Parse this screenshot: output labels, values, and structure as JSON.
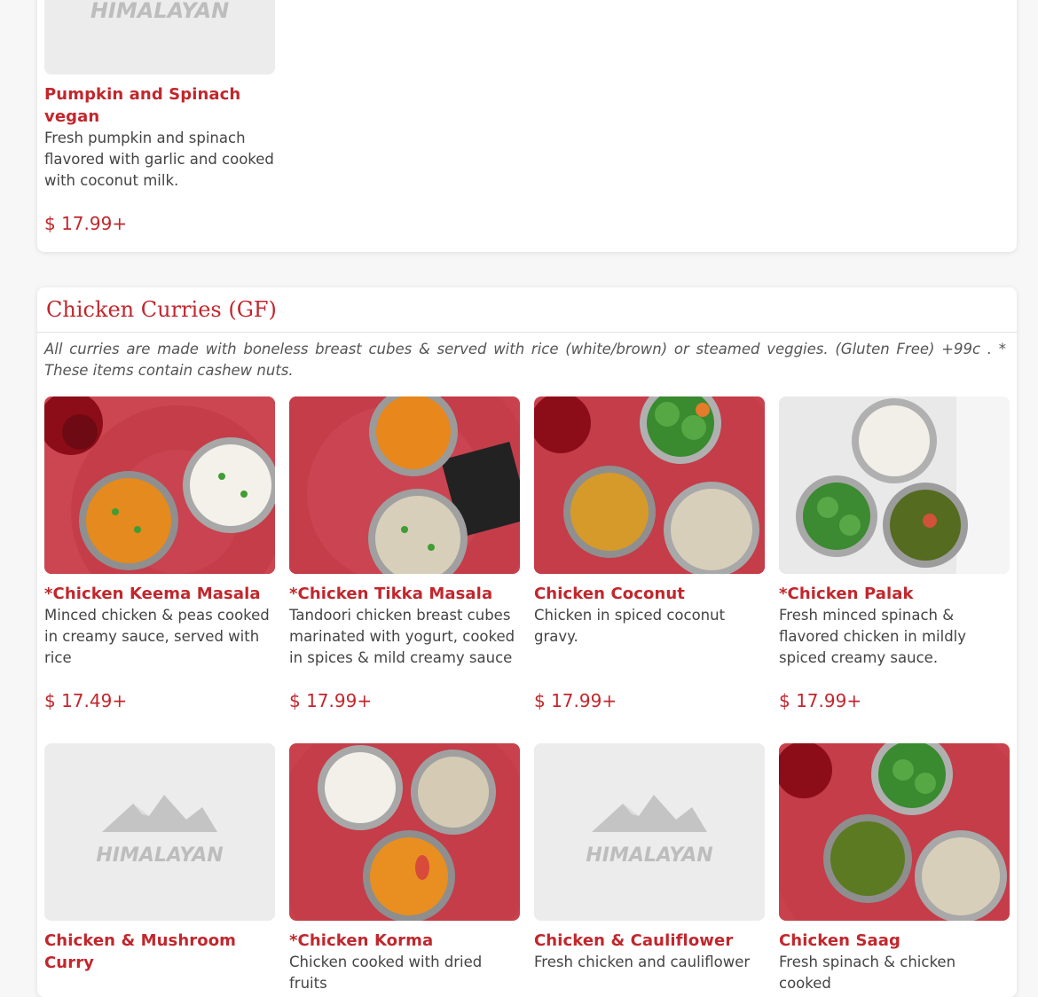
{
  "top_section": {
    "item": {
      "name": "Pumpkin and Spinach vegan",
      "description": "Fresh pumpkin and spinach flavored with garlic and cooked with coconut milk.",
      "price": "$ 17.99+",
      "image": "placeholder-logo",
      "placeholder_text": "HIMALAYAN"
    }
  },
  "chicken_section": {
    "title": "Chicken Curries (GF)",
    "note": "All curries are made with boneless breast cubes & served with rice (white/brown) or steamed veggies. (Gluten Free) +99c . * These items contain cashew nuts.",
    "items": [
      {
        "name": "*Chicken Keema Masala",
        "description": "Minced chicken & peas cooked in creamy sauce, served with rice",
        "price": "$ 17.49+",
        "image": "food-photo"
      },
      {
        "name": "*Chicken Tikka Masala",
        "description": "Tandoori chicken breast cubes marinated with yogurt, cooked in spices & mild creamy sauce",
        "price": "$ 17.99+",
        "image": "food-photo"
      },
      {
        "name": "Chicken Coconut",
        "description": "Chicken in spiced coconut gravy.",
        "price": "$ 17.99+",
        "image": "food-photo"
      },
      {
        "name": "*Chicken Palak",
        "description": "Fresh minced spinach & flavored chicken in mildly spiced creamy sauce.",
        "price": "$ 17.99+",
        "image": "food-photo"
      },
      {
        "name": "Chicken & Mushroom Curry",
        "description": "",
        "image": "placeholder-logo",
        "placeholder_text": "HIMALAYAN"
      },
      {
        "name": "*Chicken Korma",
        "description": "Chicken cooked with dried fruits",
        "image": "food-photo"
      },
      {
        "name": "Chicken & Cauliflower",
        "description": "Fresh chicken and cauliflower",
        "image": "placeholder-logo",
        "placeholder_text": "HIMALAYAN"
      },
      {
        "name": "Chicken Saag",
        "description": "Fresh spinach & chicken cooked",
        "image": "food-photo"
      }
    ]
  },
  "colors": {
    "accent": "#c1272d",
    "placemat": "#c8414c",
    "placeholder_bg": "#ececec"
  }
}
